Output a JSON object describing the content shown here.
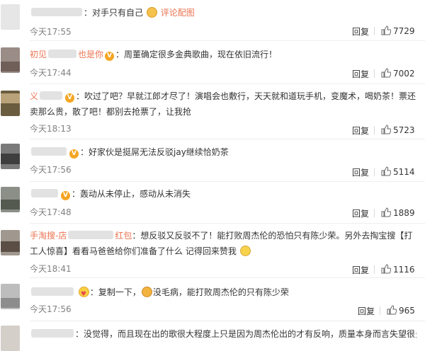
{
  "colors": {
    "name": "#eb7350",
    "link": "#eb7350",
    "time": "#808080",
    "text": "#333333",
    "badge": "#f5a623"
  },
  "actions": {
    "reply_label": "回复"
  },
  "comments": [
    {
      "name": "",
      "badge": false,
      "sep": "：",
      "text": "对手只有自己",
      "link": "评论配图",
      "emoji": "thumb-emoji",
      "time": "今天17:55",
      "likes": "7729"
    },
    {
      "name": "初见",
      "name_tail": "也是你",
      "badge": true,
      "sep": "：",
      "text": "周董确定很多金典歌曲，现在依旧流行！",
      "time": "今天17:44",
      "likes": "7002"
    },
    {
      "name": "义",
      "badge": true,
      "sep": "：",
      "text": "吹过了吧？早就江郎才尽了！演唱会也敷行，天天就和道玩手机，变魔术，喝奶茶！票还卖那么贵，散了吧！都别去抢票了，让我抢",
      "time": "今天18:13",
      "likes": "5723"
    },
    {
      "name": "",
      "badge": true,
      "sep": "：",
      "text": "好家伙是挺屌无法反驳jay继续恰奶茶",
      "time": "今天17:56",
      "likes": "5114"
    },
    {
      "name": "",
      "badge": true,
      "sep": "：",
      "text": "轰动从未停止，感动从未消失",
      "time": "今天17:48",
      "likes": "1889"
    },
    {
      "name": "手淘搜-店",
      "name_tail": "红包",
      "badge": false,
      "sep": "：",
      "text": "想反驳又反驳不了！能打败周杰伦的恐怕只有陈少荣。另外去掏宝搜【打工人惊喜】看看马爸爸给你们准备了什么 记得回来赞我",
      "emoji": "grin-emoji",
      "time": "今天18:41",
      "likes": "1116"
    },
    {
      "name": "",
      "badge": false,
      "sep": "：",
      "text": "复制一下，",
      "text2": "没毛病，能打败周杰伦的只有陈少荣",
      "time": "今天17:56",
      "likes": "965"
    },
    {
      "name": "",
      "badge": false,
      "sep": "：",
      "text": "没觉得，而且现在出的歌很大程度上只是因为周杰伦出的才有反响，质量本身而言失望很多"
    }
  ]
}
